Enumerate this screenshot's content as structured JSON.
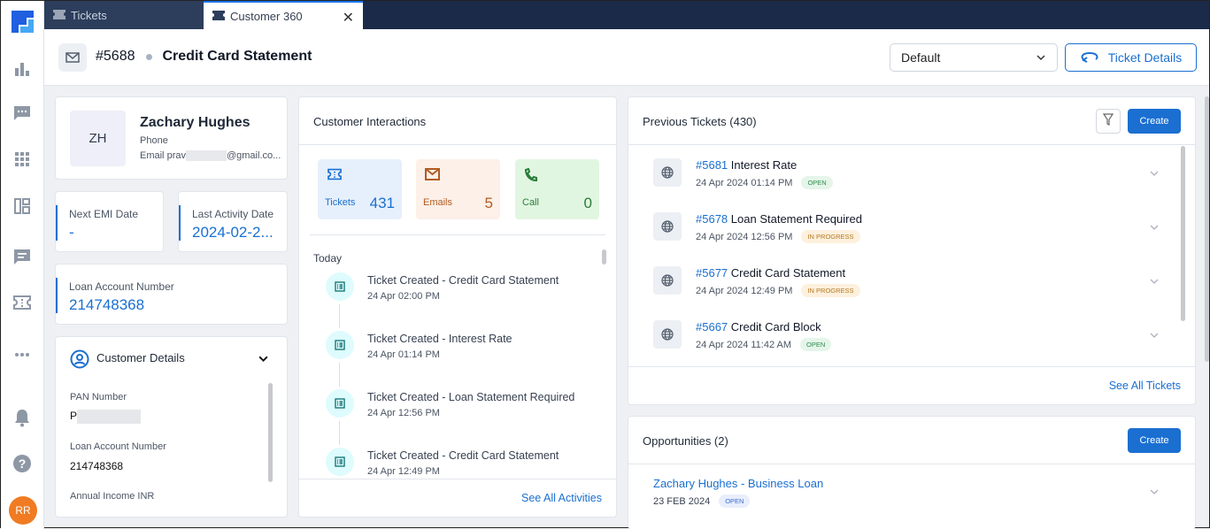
{
  "tabs": [
    {
      "label": "Tickets",
      "icon": "ticket-icon"
    },
    {
      "label": "Customer 360",
      "icon": "ticket-icon",
      "active": true
    }
  ],
  "rail": {
    "items": [
      "analytics-icon",
      "chat-icon",
      "apps-grid-icon",
      "layout-icon",
      "message-icon",
      "ticket-icon",
      "more-icon"
    ],
    "bottom": [
      "bell-icon",
      "help-icon"
    ],
    "avatar_initials": "RR",
    "avatar_color": "#f07b22"
  },
  "header": {
    "ticket_id": "#5688",
    "title": "Credit Card Statement",
    "view_select": "Default",
    "ticket_details_label": "Ticket Details"
  },
  "profile": {
    "initials": "ZH",
    "name": "Zachary Hughes",
    "phone_label": "Phone",
    "email_label": "Email",
    "email_value_start": "prav",
    "email_value_end": "@gmail.co..."
  },
  "kpis": {
    "next_emi": {
      "label": "Next EMI Date",
      "value": "-"
    },
    "last_activity": {
      "label": "Last Activity Date",
      "value": "2024-02-2..."
    },
    "loan_account": {
      "label": "Loan Account Number",
      "value": "214748368"
    }
  },
  "customer_details": {
    "title": "Customer Details",
    "fields": [
      {
        "label": "PAN Number",
        "value": "P"
      },
      {
        "label": "Loan Account Number",
        "value": "214748368"
      },
      {
        "label": "Annual Income INR",
        "value": ""
      }
    ]
  },
  "interactions": {
    "title": "Customer Interactions",
    "tiles": [
      {
        "label": "Tickets",
        "value": "431",
        "color": "#1a6fd1",
        "bg": "#e6f0fc"
      },
      {
        "label": "Emails",
        "value": "5",
        "color": "#b05c22",
        "bg": "#fcf0e8"
      },
      {
        "label": "Call",
        "value": "0",
        "color": "#2a7d3a",
        "bg": "#e1f6e1"
      }
    ],
    "group_label": "Today",
    "timeline": [
      {
        "title": "Ticket Created - Credit Card Statement",
        "time": "24 Apr 02:00 PM"
      },
      {
        "title": "Ticket Created - Interest Rate",
        "time": "24 Apr 01:14 PM"
      },
      {
        "title": "Ticket Created - Loan Statement Required",
        "time": "24 Apr 12:56 PM"
      },
      {
        "title": "Ticket Created - Credit Card Statement",
        "time": "24 Apr 12:49 PM"
      }
    ],
    "see_all": "See All Activities"
  },
  "previous_tickets": {
    "title": "Previous Tickets (430)",
    "create_label": "Create",
    "items": [
      {
        "num": "#5681",
        "title": "Interest Rate",
        "date": "24 Apr 2024 01:14 PM",
        "status": "OPEN",
        "kind": "open"
      },
      {
        "num": "#5678",
        "title": "Loan Statement Required",
        "date": "24 Apr 2024 12:56 PM",
        "status": "IN PROGRESS",
        "kind": "prog"
      },
      {
        "num": "#5677",
        "title": "Credit Card Statement",
        "date": "24 Apr 2024 12:49 PM",
        "status": "IN PROGRESS",
        "kind": "prog"
      },
      {
        "num": "#5667",
        "title": "Credit Card Block",
        "date": "24 Apr 2024 11:42 AM",
        "status": "OPEN",
        "kind": "open"
      }
    ],
    "see_all": "See All Tickets"
  },
  "opportunities": {
    "title": "Opportunities (2)",
    "create_label": "Create",
    "items": [
      {
        "title": "Zachary Hughes - Business Loan",
        "date": "23 FEB 2024",
        "status": "OPEN"
      }
    ]
  }
}
